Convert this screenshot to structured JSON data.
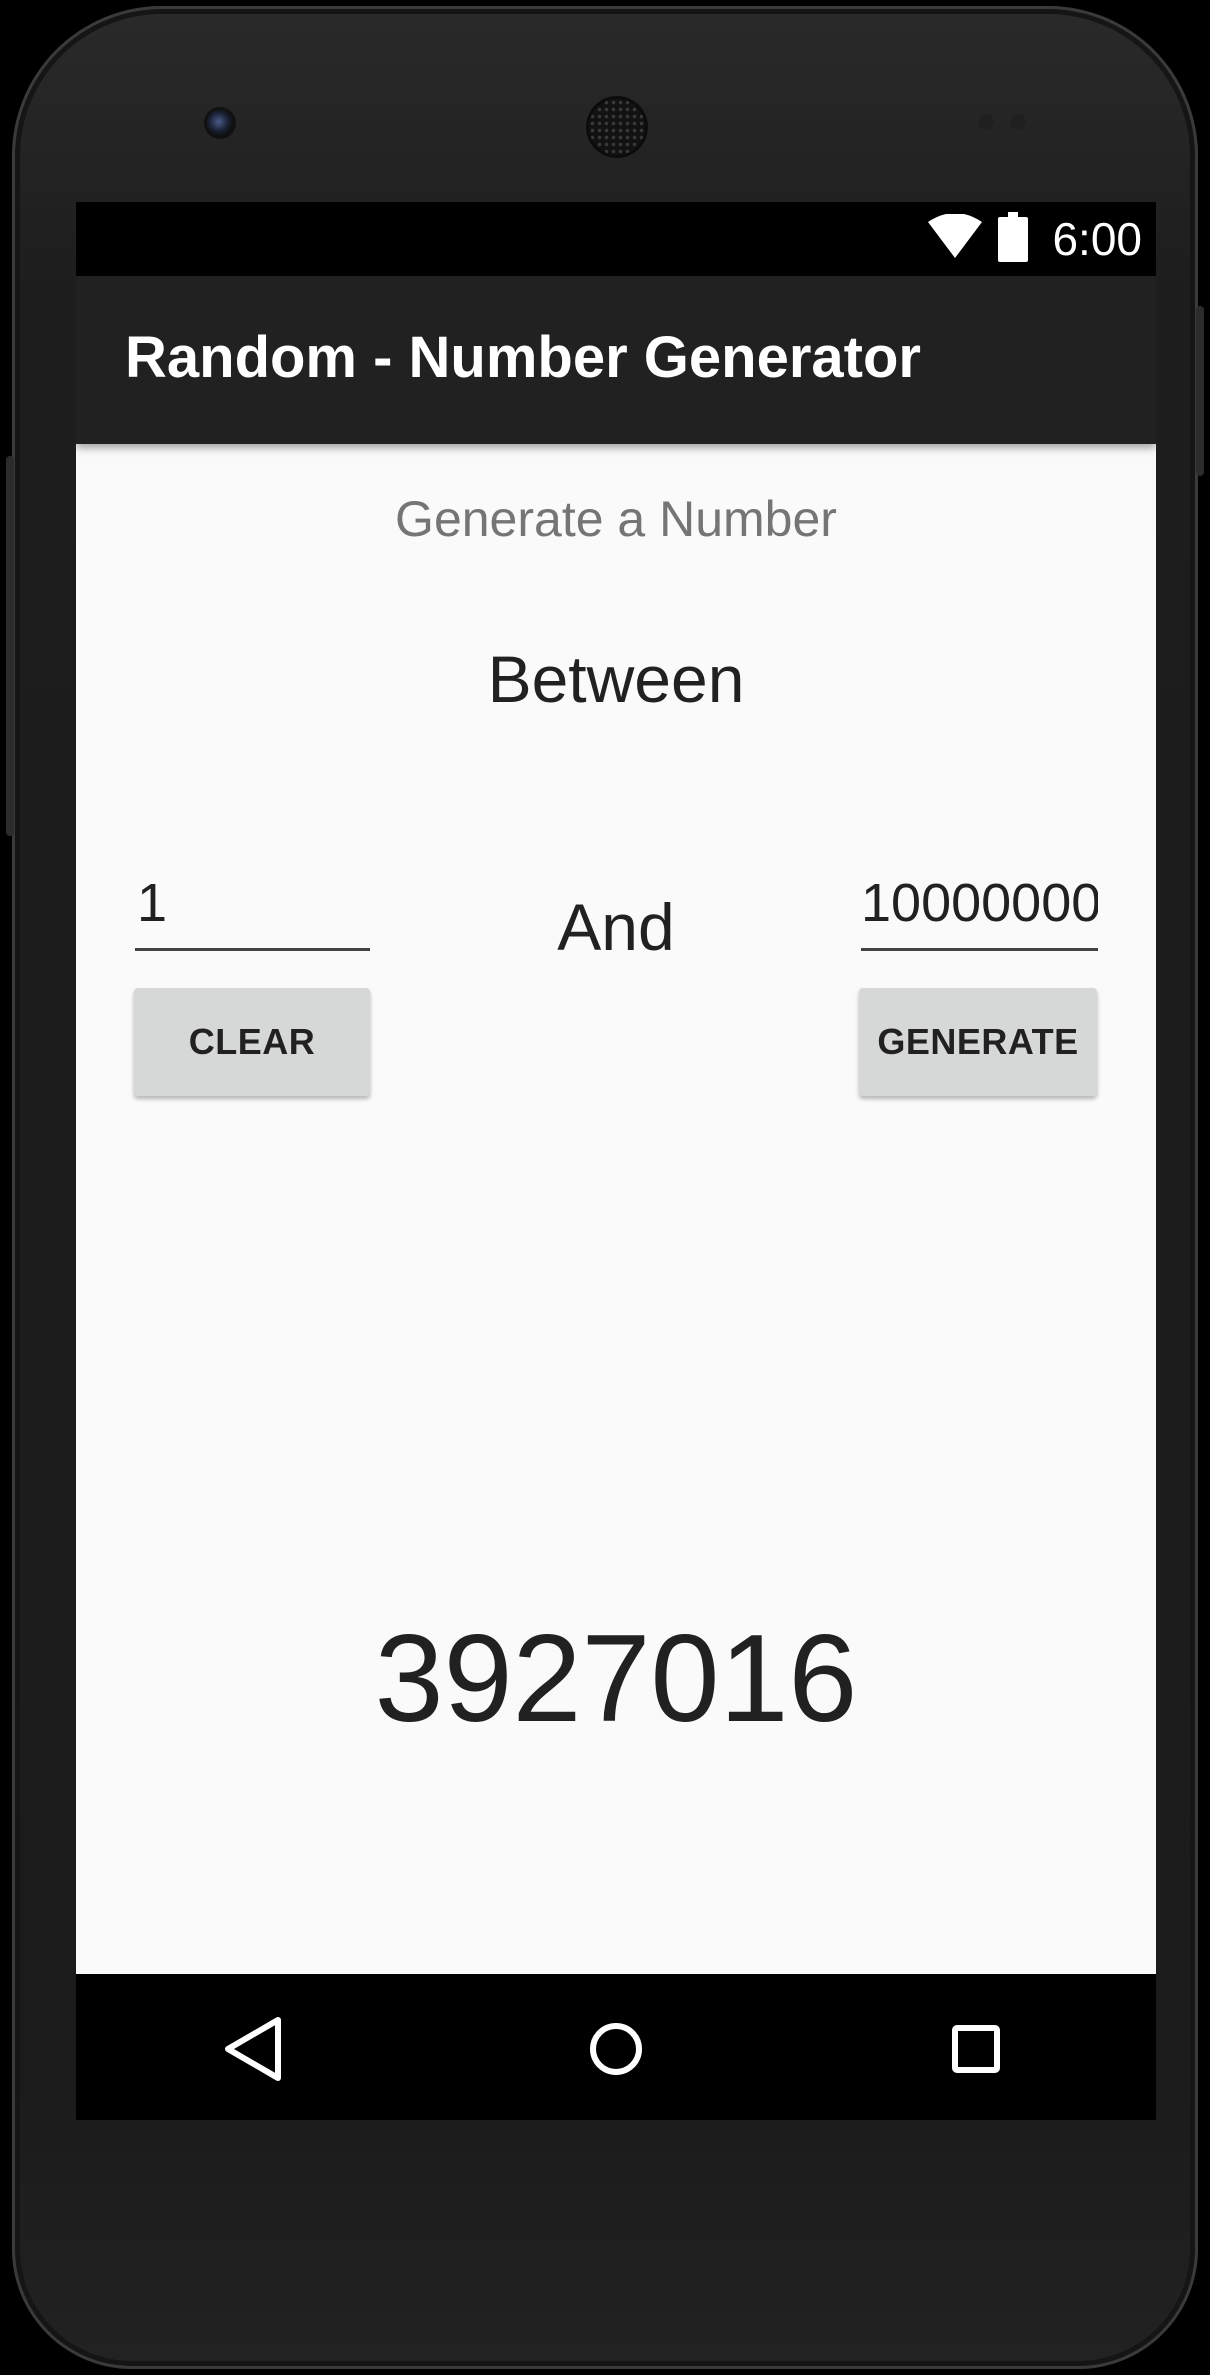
{
  "status_bar": {
    "time": "6:00",
    "icons": [
      "wifi-icon",
      "battery-icon"
    ]
  },
  "app_bar": {
    "title": "Random - Number Generator"
  },
  "main": {
    "heading": "Generate a Number",
    "between_label": "Between",
    "and_label": "And",
    "min_value": "1",
    "max_value": "10000000",
    "clear_button": "CLEAR",
    "generate_button": "GENERATE",
    "result": "3927016"
  },
  "navigation": {
    "icons": [
      "back-icon",
      "home-icon",
      "recents-icon"
    ]
  },
  "colors": {
    "app_bar": "#212121",
    "status_bar": "#000000",
    "content_background": "#fafafa",
    "button_background": "#d6d7d7",
    "primary_text": "#212121",
    "secondary_text": "#757575"
  }
}
